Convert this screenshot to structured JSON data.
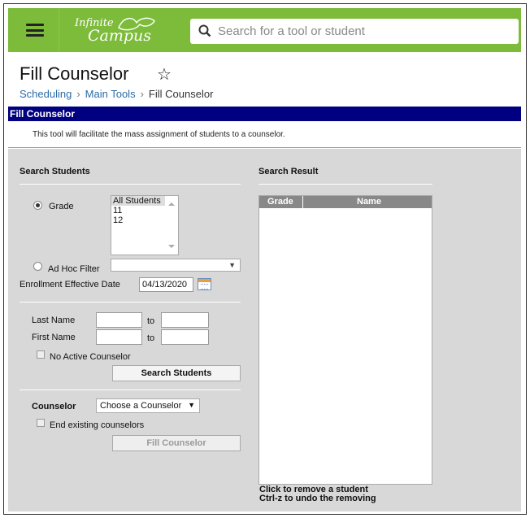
{
  "header": {
    "logo_line1": "Infinite",
    "logo_line2": "Campus",
    "search_placeholder": "Search for a tool or student",
    "accent_color": "#7dbb3b"
  },
  "page": {
    "title": "Fill Counselor",
    "favorite_icon": "star-outline-icon",
    "breadcrumb": [
      "Scheduling",
      "Main Tools",
      "Fill Counselor"
    ]
  },
  "tool": {
    "bar_title": "Fill Counselor",
    "description": "This tool will facilitate the mass assignment of students to a counselor."
  },
  "search_students": {
    "section_title": "Search Students",
    "grade_label": "Grade",
    "grade_options": [
      "All Students",
      "11",
      "12"
    ],
    "grade_selected": "All Students",
    "adhoc_label": "Ad Hoc Filter",
    "adhoc_value": "",
    "enrollment_label": "Enrollment Effective Date",
    "enrollment_date": "04/13/2020",
    "last_name_label": "Last Name",
    "first_name_label": "First Name",
    "to_label": "to",
    "no_active_counselor_label": "No Active Counselor",
    "search_button": "Search Students"
  },
  "counselor": {
    "label": "Counselor",
    "select_value": "Choose a Counselor",
    "end_existing_label": "End existing counselors",
    "fill_button": "Fill Counselor"
  },
  "search_result": {
    "section_title": "Search Result",
    "columns": [
      "Grade",
      "Name"
    ],
    "hint1": "Click to remove a student",
    "hint2": "Ctrl-z to undo the removing"
  }
}
